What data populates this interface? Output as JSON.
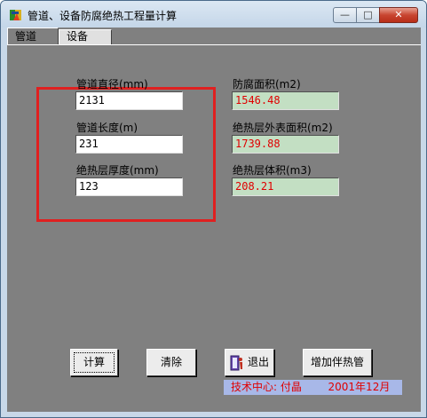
{
  "window": {
    "title": "管道、设备防腐绝热工程量计算",
    "controls": {
      "minimize": "—",
      "maximize": "□",
      "close": "✕"
    }
  },
  "tabs": [
    {
      "label": "管道",
      "active": true
    },
    {
      "label": "设备",
      "active": false
    }
  ],
  "inputs": {
    "pipe_diameter": {
      "label": "管道直径(mm)",
      "value": "2131"
    },
    "pipe_length": {
      "label": "管道长度(m)",
      "value": "231"
    },
    "insulation_thickness": {
      "label": "绝热层厚度(mm)",
      "value": "123"
    }
  },
  "outputs": {
    "anticorrosion_area": {
      "label": "防腐面积(m2)",
      "value": "1546.48"
    },
    "insulation_outer_area": {
      "label": "绝热层外表面积(m2)",
      "value": "1739.88"
    },
    "insulation_volume": {
      "label": "绝热层体积(m3)",
      "value": "208.21"
    }
  },
  "buttons": {
    "calculate": "计算",
    "clear": "清除",
    "exit": "退出",
    "add_tracing": "增加伴热管"
  },
  "footer": {
    "credit": "技术中心: 付晶",
    "date": "2001年12月"
  },
  "colors": {
    "panel_bg": "#808080",
    "output_bg": "#c3dfc3",
    "output_text": "#e00000",
    "highlight_border": "#e02020",
    "footer_bg": "#a8b8e8"
  },
  "icons": {
    "app": "app-logo-icon",
    "exit": "exit-door-icon"
  }
}
